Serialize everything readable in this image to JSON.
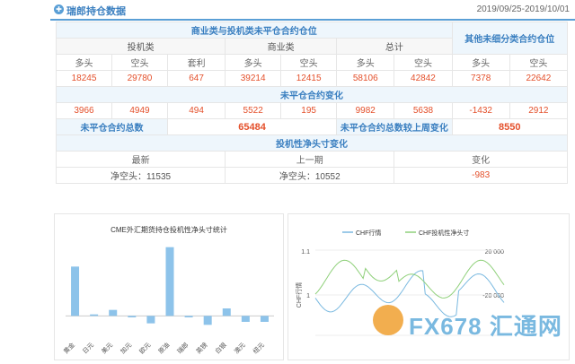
{
  "header": {
    "icon_glyph": "✚",
    "icon": "add-circle-icon",
    "title": "瑞郎持仓数据",
    "date_range": "2019/09/25-2019/10/01"
  },
  "table": {
    "group_header": "商业类与投机类未平仓合约仓位",
    "other_header": "其他未细分类合约仓位",
    "subgroups": [
      "投机类",
      "商业类",
      "总计"
    ],
    "columns": [
      "多头",
      "空头",
      "套利",
      "多头",
      "空头",
      "多头",
      "空头",
      "多头",
      "空头"
    ],
    "positions": [
      "18245",
      "29780",
      "647",
      "39214",
      "12415",
      "58106",
      "42842",
      "7378",
      "22642"
    ],
    "change_header": "未平仓合约变化",
    "changes": [
      "3966",
      "4949",
      "494",
      "5522",
      "195",
      "9982",
      "5638",
      "-1432",
      "2912"
    ],
    "oi_total_label": "未平仓合约总数",
    "oi_total_value": "65484",
    "oi_change_label": "未平仓合约总数较上周变化",
    "oi_change_value": "8550",
    "spec_header": "投机性净头寸变化",
    "spec_cols": [
      "最新",
      "上一期",
      "变化"
    ],
    "spec_values": [
      "净空头：11535",
      "净空头：10552",
      "-983"
    ]
  },
  "chart_data": [
    {
      "type": "bar",
      "title": "CME外汇期货持仓投机性净头寸统计",
      "categories": [
        "黄金",
        "日元",
        "美元",
        "加元",
        "欧元",
        "原油",
        "瑞郎",
        "英镑",
        "白银",
        "澳元",
        "纽元"
      ],
      "values": [
        33,
        1,
        4,
        -1,
        -5,
        46,
        -1,
        -6,
        5,
        -4,
        -4
      ],
      "ylim": [
        -10,
        50
      ],
      "color": "#8dc3ea"
    },
    {
      "type": "line",
      "series": [
        {
          "name": "CHF行情",
          "color": "#7ab9e0"
        },
        {
          "name": "CHF投机性净头寸",
          "color": "#8fd07a"
        }
      ],
      "ylabel": "CHF行情",
      "left_ticks": [
        "1.1",
        "1"
      ],
      "right_ticks": [
        "20 000",
        "-20 000"
      ]
    }
  ],
  "watermark": {
    "text": "FX678 汇通网"
  }
}
